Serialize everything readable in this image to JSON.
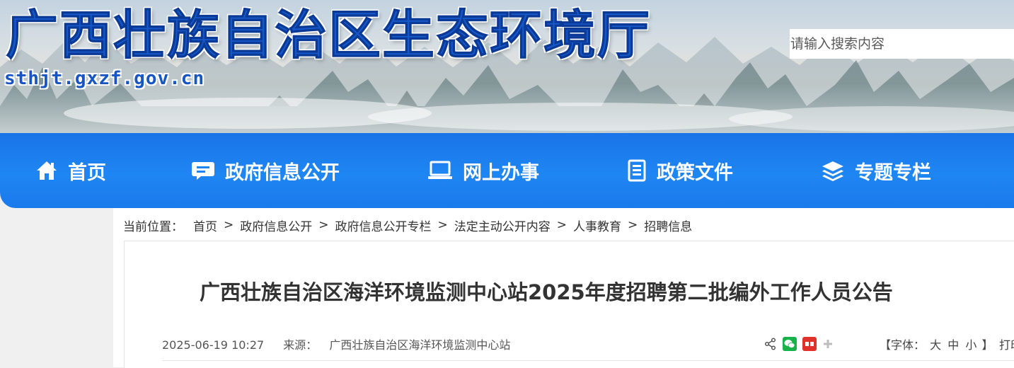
{
  "site": {
    "title": "广西壮族自治区生态环境厅",
    "domain": "sthjt.gxzf.gov.cn"
  },
  "search": {
    "placeholder": "请输入搜索内容"
  },
  "nav": {
    "items": [
      {
        "label": "首页",
        "icon": "home-icon"
      },
      {
        "label": "政府信息公开",
        "icon": "message-icon"
      },
      {
        "label": "网上办事",
        "icon": "laptop-icon"
      },
      {
        "label": "政策文件",
        "icon": "document-icon"
      },
      {
        "label": "专题专栏",
        "icon": "layers-icon"
      }
    ]
  },
  "breadcrumb": {
    "lead": "当前位置：",
    "separator": ">",
    "items": [
      "首页",
      "政府信息公开",
      "政府信息公开专栏",
      "法定主动公开内容",
      "人事教育",
      "招聘信息"
    ]
  },
  "article": {
    "title": "广西壮族自治区海洋环境监测中心站2025年度招聘第二批编外工作人员公告",
    "datetime": "2025-06-19 10:27",
    "source_label": "来源：",
    "source": "广西壮族自治区海洋环境监测中心站"
  },
  "share": {
    "icons": [
      "share-icon",
      "wechat-icon",
      "weibo-icon",
      "more-icon"
    ]
  },
  "font_size": {
    "open": "【字体：",
    "large": "大",
    "medium": "中",
    "small": "小",
    "close": "】"
  },
  "print_label": "打印",
  "colors": {
    "nav_blue": "#1e86f2",
    "title_blue": "#1658c8",
    "wechat_green": "#17b34a",
    "weibo_red": "#e0322b"
  }
}
